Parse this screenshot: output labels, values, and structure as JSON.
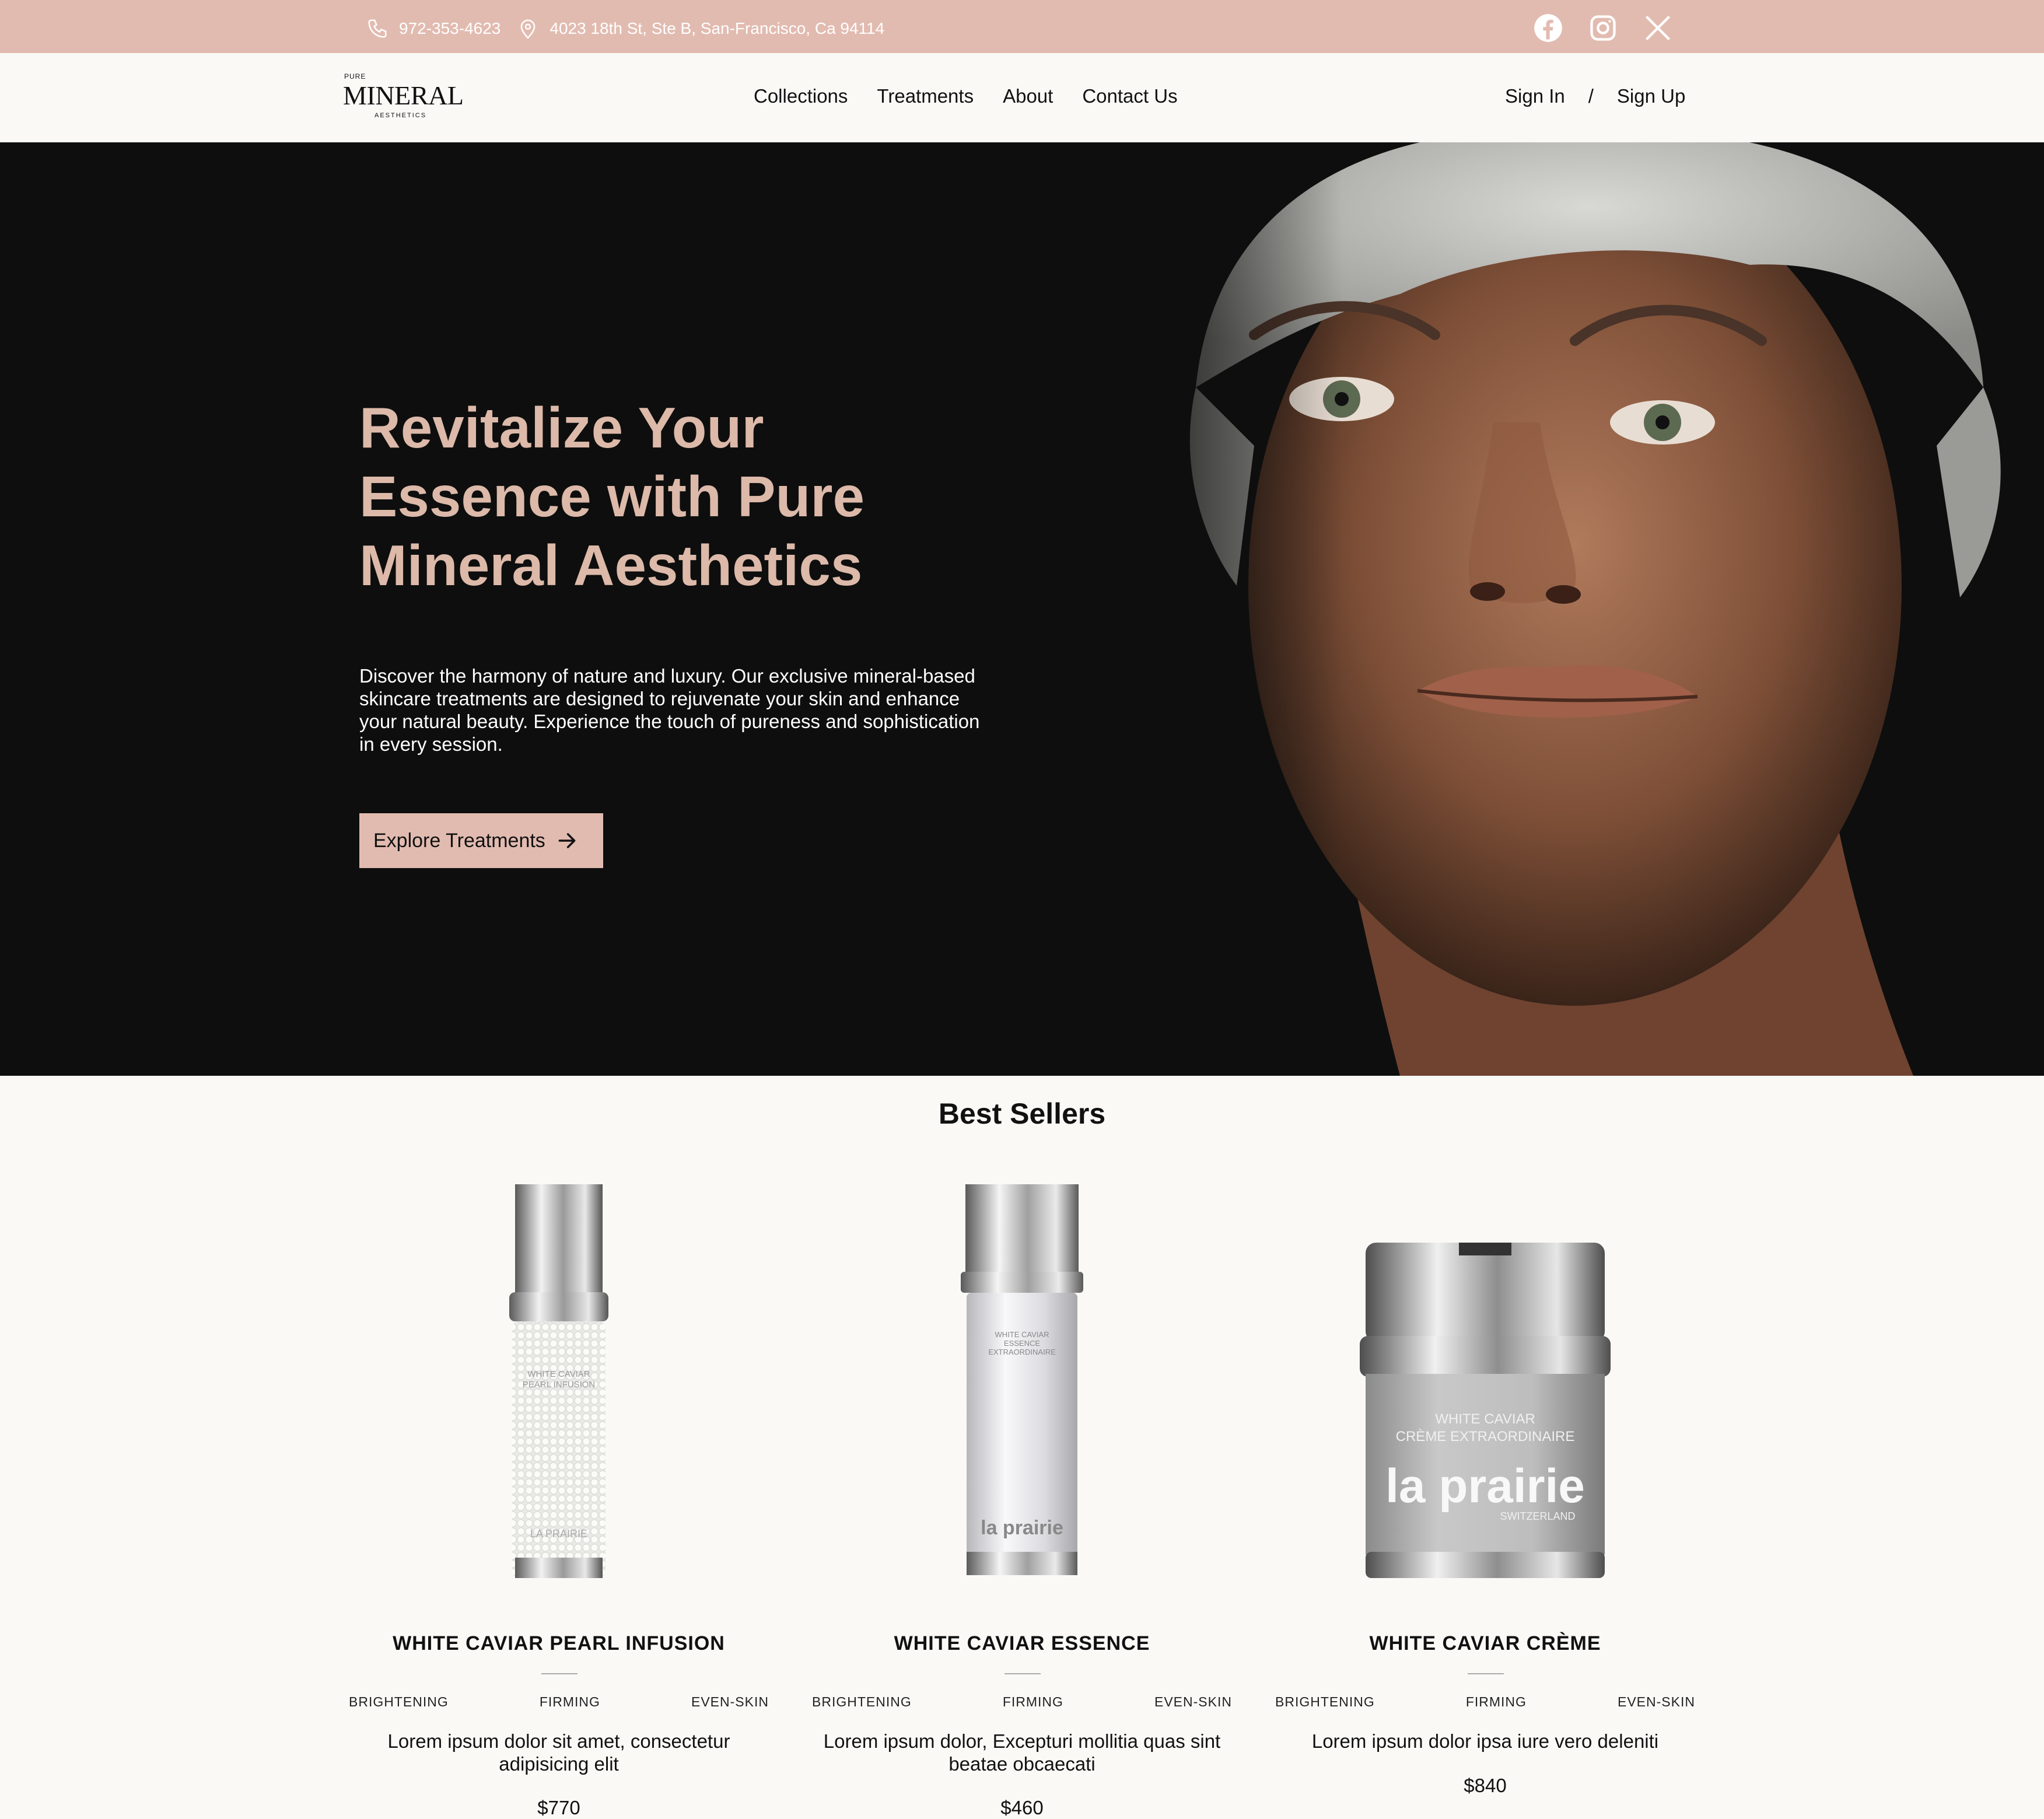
{
  "topbar": {
    "phone": "972-353-4623",
    "address": "4023 18th St, Ste B, San-Francisco, Ca 94114",
    "icons": [
      "phone-icon",
      "map-pin-icon",
      "facebook-icon",
      "instagram-icon",
      "x-icon"
    ]
  },
  "nav": {
    "logo_text_top": "PURE",
    "logo_text_main": "MINERAL",
    "logo_text_sub": "AESTHETICS",
    "menu": [
      "Collections",
      "Treatments",
      "About",
      "Contact Us"
    ],
    "sign_in": "Sign In",
    "separator": "/",
    "sign_up": "Sign Up"
  },
  "hero": {
    "title": "Revitalize Your Essence with Pure Mineral Aesthetics",
    "text": "Discover the harmony of nature and luxury. Our exclusive mineral-based skincare treatments are designed to rejuvenate your skin and enhance your natural beauty. Experience the touch of pureness and sophistication in every session.",
    "cta": "Explore Treatments"
  },
  "best_sellers": {
    "title": "Best Sellers",
    "products": [
      {
        "name": "WHITE CAVIAR PEARL INFUSION",
        "tags": [
          "BRIGHTENING",
          "FIRMING",
          "EVEN-SKIN"
        ],
        "desc": "Lorem ipsum dolor sit amet, consectetur adipisicing elit",
        "price": "$770",
        "label_line1": "WHITE CAVIAR",
        "label_line2": "PEARL INFUSION",
        "brand": "LA PRAIRIE"
      },
      {
        "name": "WHITE CAVIAR ESSENCE",
        "tags": [
          "BRIGHTENING",
          "FIRMING",
          "EVEN-SKIN"
        ],
        "desc": "Lorem ipsum dolor, Excepturi mollitia quas sint beatae obcaecati",
        "price": "$460",
        "label_line1": "WHITE CAVIAR",
        "label_line2": "ESSENCE",
        "label_line3": "EXTRAORDINAIRE",
        "brand": "la prairie"
      },
      {
        "name": "WHITE CAVIAR CRÈME",
        "tags": [
          "BRIGHTENING",
          "FIRMING",
          "EVEN-SKIN"
        ],
        "desc": "Lorem ipsum dolor ipsa iure vero deleniti",
        "price": "$840",
        "label_line1": "WHITE CAVIAR",
        "label_line2": "CRÈME EXTRAORDINAIRE",
        "brand": "la prairie",
        "brand_sub": "SWITZERLAND"
      }
    ]
  },
  "colors": {
    "accent": "#e2bbb0",
    "hero_title": "#dcb9a9",
    "hero_bg": "#0e0e0e",
    "page_bg": "#faf9f6"
  }
}
